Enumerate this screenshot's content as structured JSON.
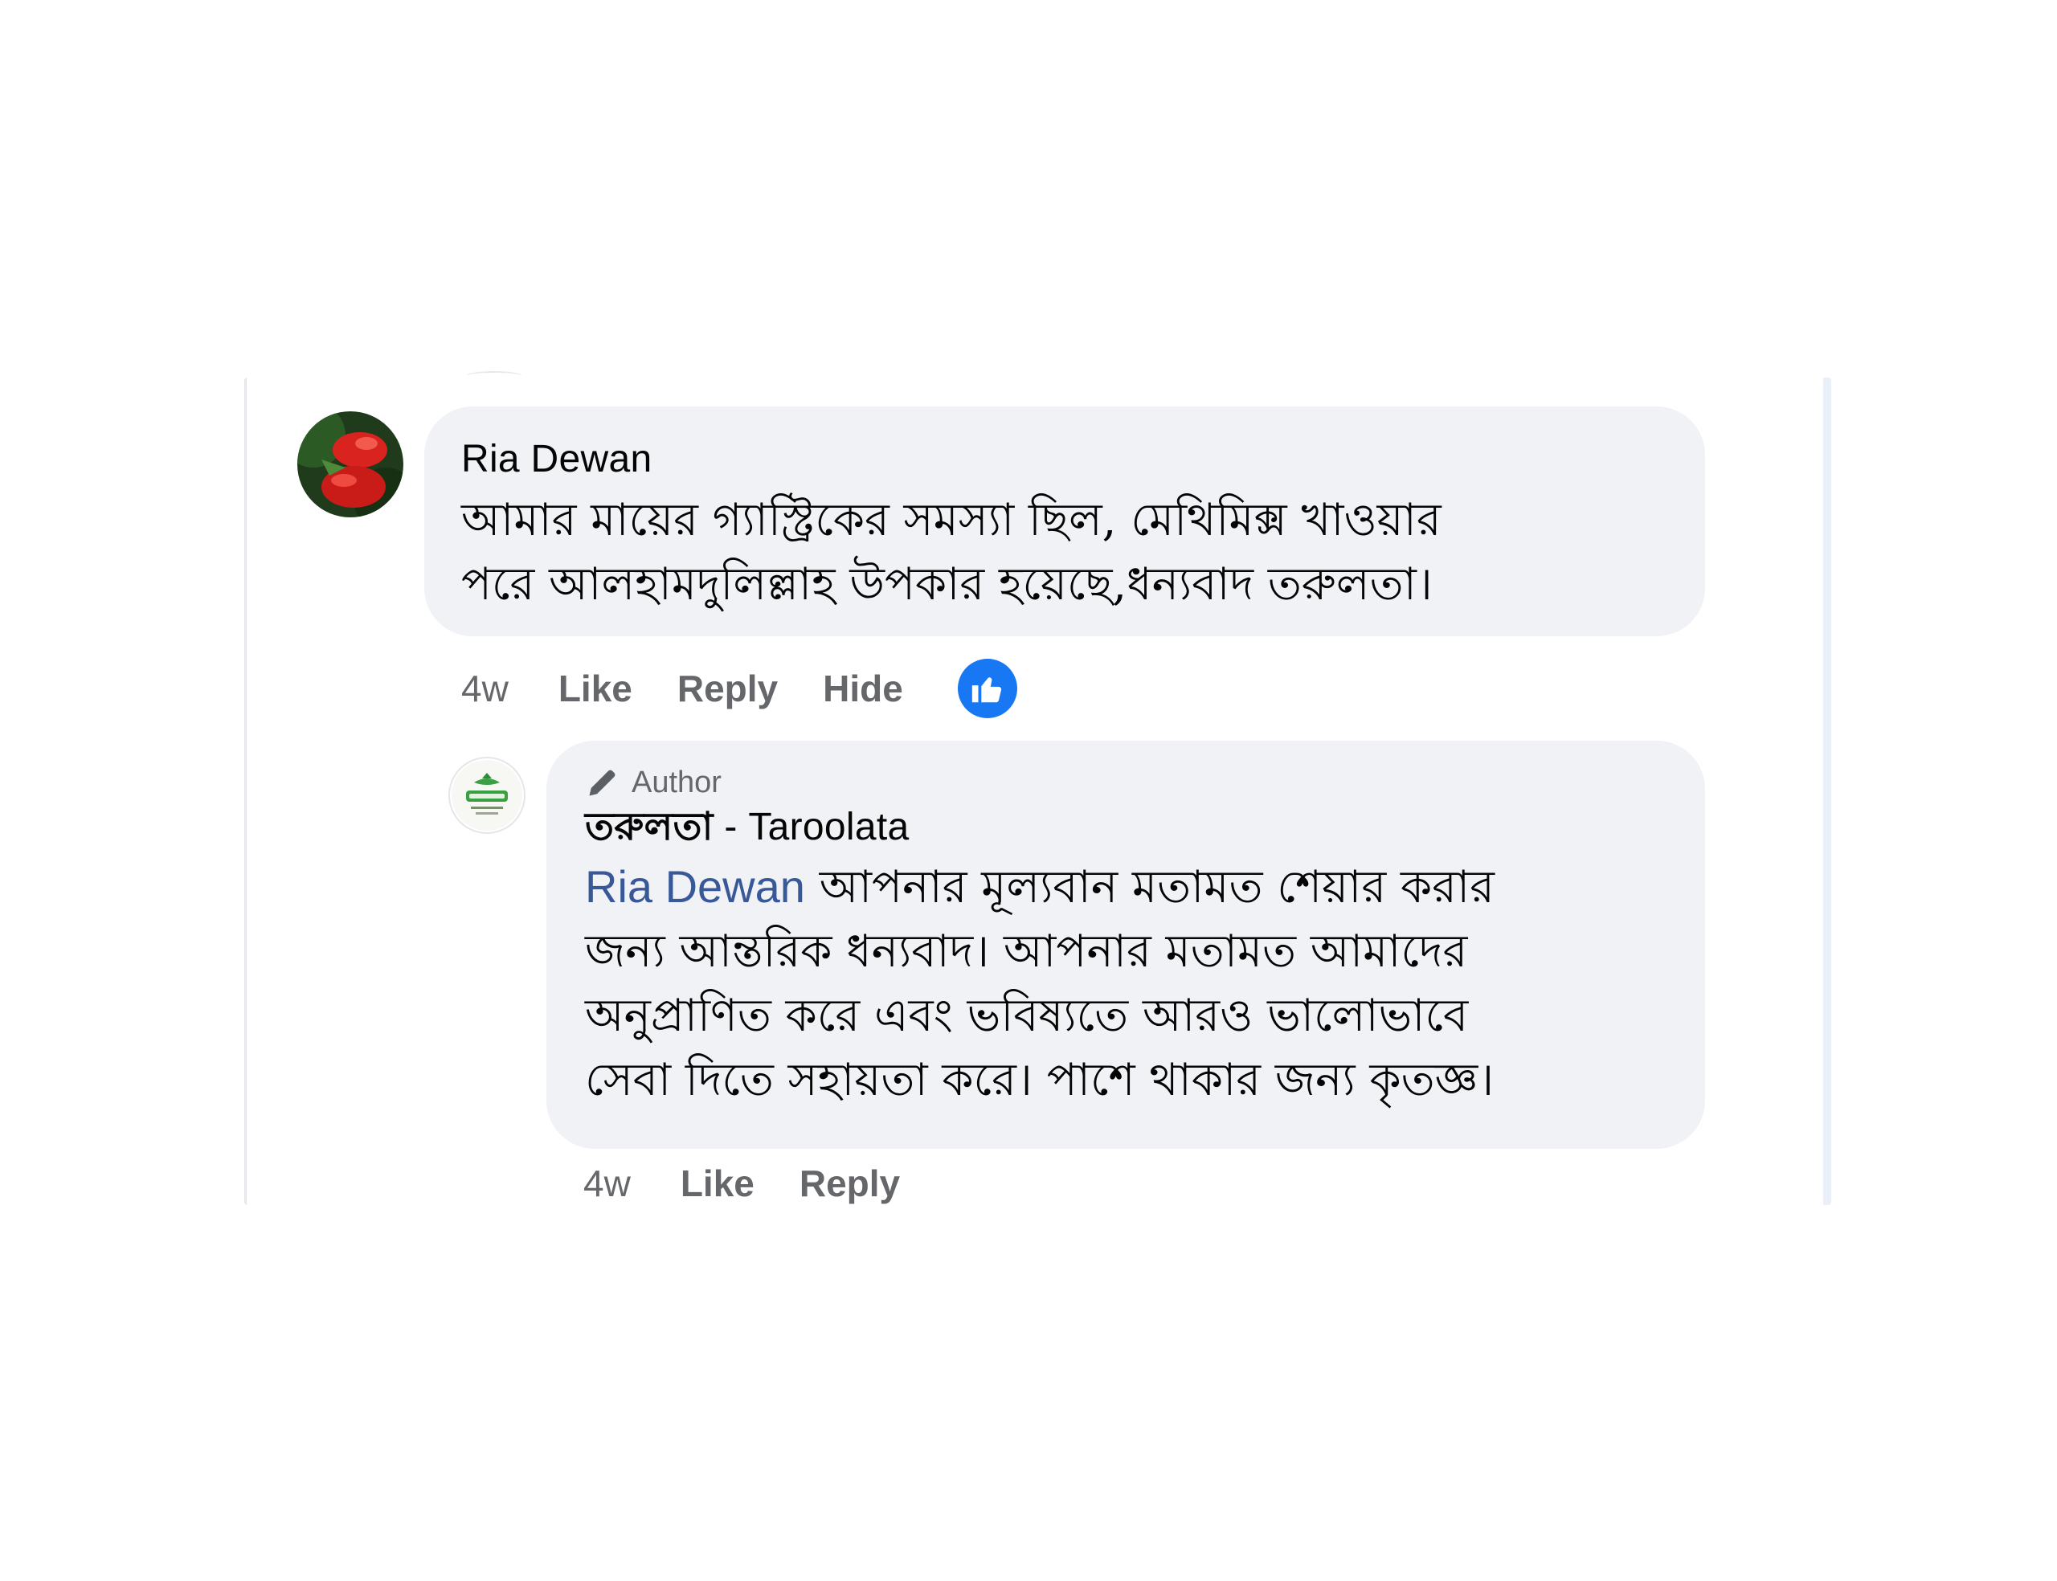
{
  "comment": {
    "author": "Ria Dewan",
    "text": "আমার মায়ের গ্যাস্ট্রিকের সমস্যা ছিল, মেথিমিক্স খাওয়ার\nপরে আলহামদুলিল্লাহ উপকার হয়েছে,ধন্যবাদ তরুলতা।",
    "time": "4w",
    "like_label": "Like",
    "reply_label": "Reply",
    "hide_label": "Hide",
    "reaction_icon": "like-reaction-icon"
  },
  "reply": {
    "badge": "Author",
    "author_bn": "তরুলতা",
    "author_sep": " - ",
    "author_en": "Taroolata",
    "mention": "Ria Dewan",
    "text": " আপনার মূল্যবান মতামত শেয়ার করার\nজন্য আন্তরিক ধন্যবাদ। আপনার মতামত আমাদের\nঅনুপ্রাণিত করে এবং ভবিষ্যতে আরও ভালোভাবে\nসেবা দিতে সহায়তা করে। পাশে থাকার জন্য কৃতজ্ঞ।",
    "time": "4w",
    "like_label": "Like",
    "reply_label": "Reply"
  },
  "colors": {
    "bubble": "#f0f2f5",
    "meta_text": "#65676b",
    "mention": "#385898",
    "reaction": "#1877f2"
  }
}
